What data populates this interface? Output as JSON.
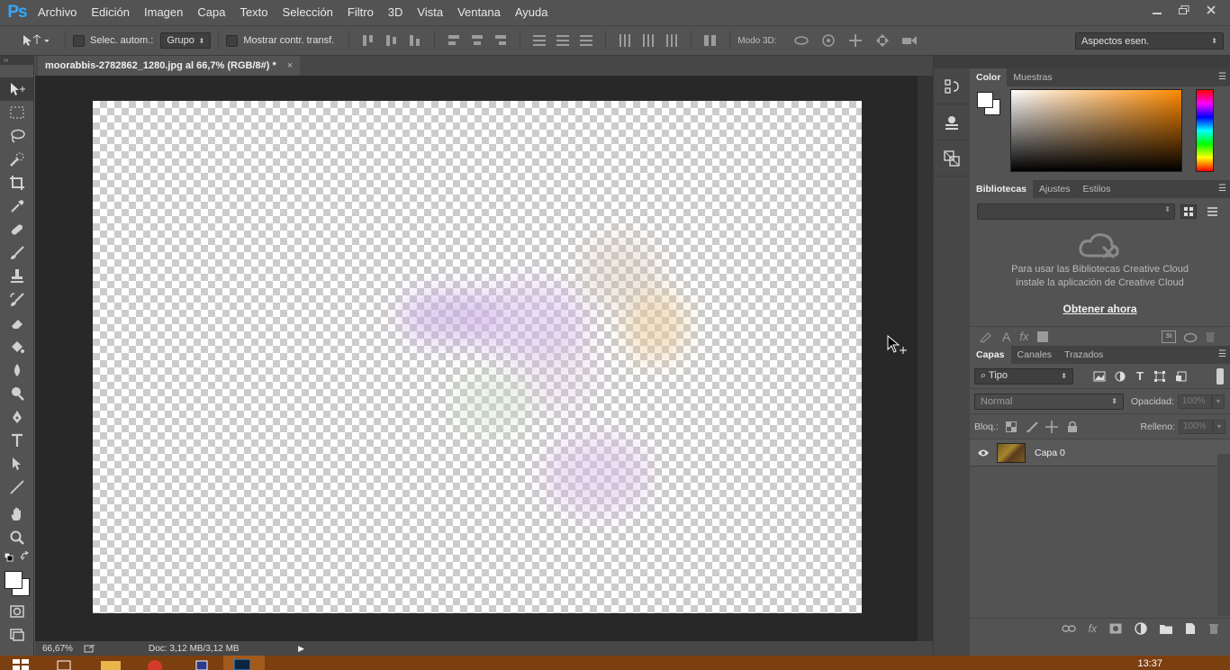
{
  "app": {
    "logo": "Ps"
  },
  "menu": [
    "Archivo",
    "Edición",
    "Imagen",
    "Capa",
    "Texto",
    "Selección",
    "Filtro",
    "3D",
    "Vista",
    "Ventana",
    "Ayuda"
  ],
  "options": {
    "auto_select_label": "Selec. autom.:",
    "auto_select_value": "Grupo",
    "transform_label": "Mostrar contr. transf.",
    "mode3d_label": "Modo 3D:",
    "workspace": "Aspectos esen."
  },
  "document": {
    "tab_title": "moorabbis-2782862_1280.jpg al 66,7% (RGB/8#) *",
    "close": "×",
    "zoom": "66,67%",
    "doc_info": "Doc: 3,12 MB/3,12 MB"
  },
  "color_panel": {
    "tabs": [
      "Color",
      "Muestras"
    ]
  },
  "libraries_panel": {
    "tabs": [
      "Bibliotecas",
      "Ajustes",
      "Estilos"
    ],
    "message_line1": "Para usar las Bibliotecas Creative Cloud",
    "message_line2": "instale la aplicación de Creative Cloud",
    "link": "Obtener ahora"
  },
  "layers_panel": {
    "tabs": [
      "Capas",
      "Canales",
      "Trazados"
    ],
    "filter_kind": "Tipo",
    "blend_mode": "Normal",
    "opacity_label": "Opacidad:",
    "opacity_value": "100%",
    "lock_label": "Bloq.:",
    "fill_label": "Relleno:",
    "fill_value": "100%",
    "layers": [
      {
        "name": "Capa 0",
        "visible": true
      }
    ]
  },
  "taskbar": {
    "time": "13:37"
  }
}
